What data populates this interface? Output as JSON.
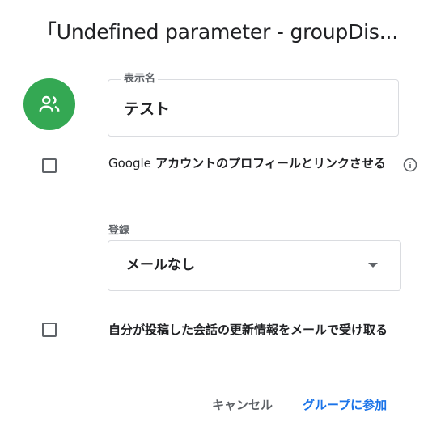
{
  "dialog": {
    "title": "「Undefined parameter - groupDis..."
  },
  "name_field": {
    "label": "表示名",
    "value": "テスト"
  },
  "options": {
    "link_profile": {
      "brand": "Google",
      "text": " アカウントのプロフィールとリンクさせる"
    },
    "subscription": {
      "label": "登録",
      "selected": "メールなし"
    },
    "notify_updates": {
      "text": "自分が投稿した会話の更新情報をメールで受け取る"
    }
  },
  "actions": {
    "cancel": "キャンセル",
    "join": "グループに参加"
  },
  "colors": {
    "accent": "#1a73e8",
    "avatar": "#34a853"
  }
}
